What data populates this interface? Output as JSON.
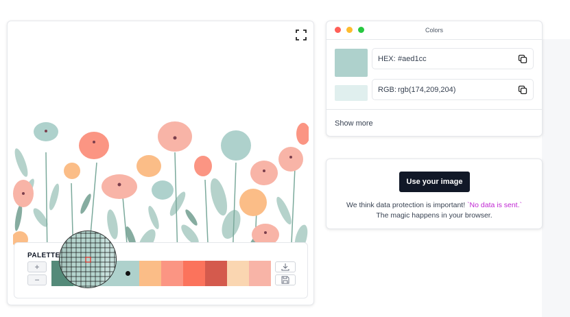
{
  "image_panel": {
    "palette_title": "PALETTE",
    "add_label": "+",
    "remove_label": "−",
    "swatches": [
      "#548a79",
      "#89b4a6",
      "#aed1cc",
      "#fbbd87",
      "#fb9583",
      "#fb735c",
      "#d45a4d",
      "#fad6b1",
      "#f8b4a7"
    ]
  },
  "colors_window": {
    "title": "Colors",
    "selected_color": "#aed1cc",
    "secondary_color": "#e0efee",
    "hex_label": "HEX:",
    "hex_value": "#aed1cc",
    "rgb_label": "RGB:",
    "rgb_value": "rgb(174,209,204)",
    "show_more": "Show more",
    "traffic_lights": [
      "#ff5f57",
      "#febc2e",
      "#28c840"
    ]
  },
  "use_image": {
    "button_label": "Use your image",
    "notice": "We think data protection is important!",
    "notice_highlight": "`No data is sent.`",
    "notice_line2": "The magic happens in your browser."
  },
  "icons": [
    "fullscreen-icon",
    "copy-icon",
    "download-icon",
    "save-icon"
  ]
}
